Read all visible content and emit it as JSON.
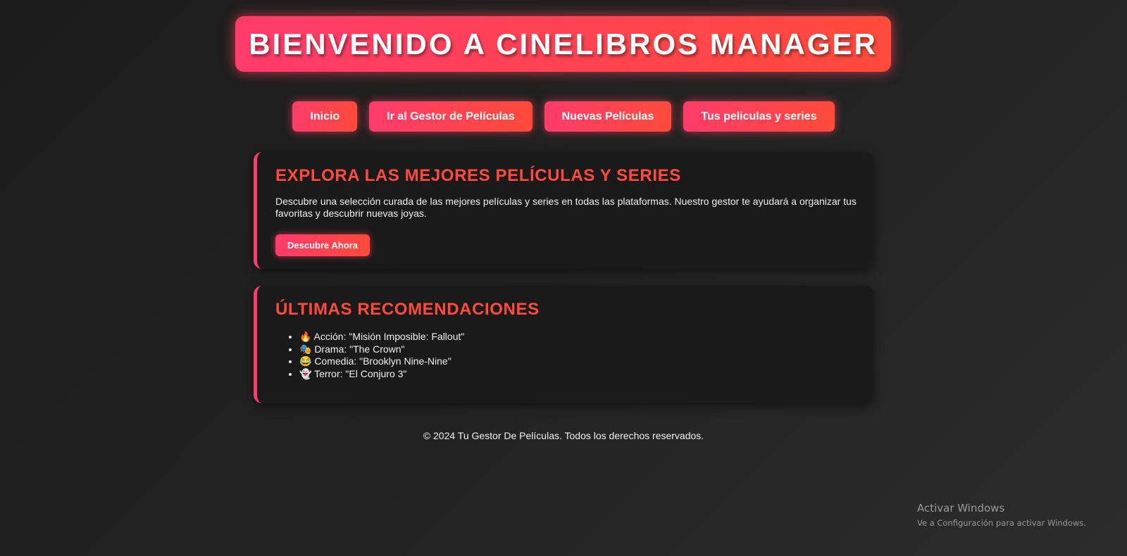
{
  "header": {
    "title": "BIENVENIDO A CINELIBROS MANAGER"
  },
  "nav": {
    "items": [
      {
        "label": "Inicio"
      },
      {
        "label": "Ir al Gestor de Películas"
      },
      {
        "label": "Nuevas Películas"
      },
      {
        "label": "Tus peliculas y series"
      }
    ]
  },
  "explore": {
    "heading": "EXPLORA LAS MEJORES PELÍCULAS Y SERIES",
    "description": "Descubre una selección curada de las mejores películas y series en todas las plataformas. Nuestro gestor te ayudará a organizar tus favoritas y descubrir nuevas joyas.",
    "cta_label": "Descubre Ahora"
  },
  "recommendations": {
    "heading": "ÚLTIMAS RECOMENDACIONES",
    "items": [
      {
        "text": "🔥 Acción: \"Misión Imposible: Fallout\""
      },
      {
        "text": "🎭 Drama: \"The Crown\""
      },
      {
        "text": "😂 Comedia: \"Brooklyn Nine-Nine\""
      },
      {
        "text": "👻 Terror: \"El Conjuro 3\""
      }
    ]
  },
  "footer": {
    "text": "© 2024 Tu Gestor De Películas. Todos los derechos reservados."
  },
  "watermark": {
    "title": "Activar Windows",
    "subtitle": "Ve a Configuración para activar Windows."
  },
  "colors": {
    "background": "#222222",
    "accent_pink": "#ff3b6b",
    "accent_orange": "#ff4a3a",
    "card_background": "#1a1a1a"
  }
}
